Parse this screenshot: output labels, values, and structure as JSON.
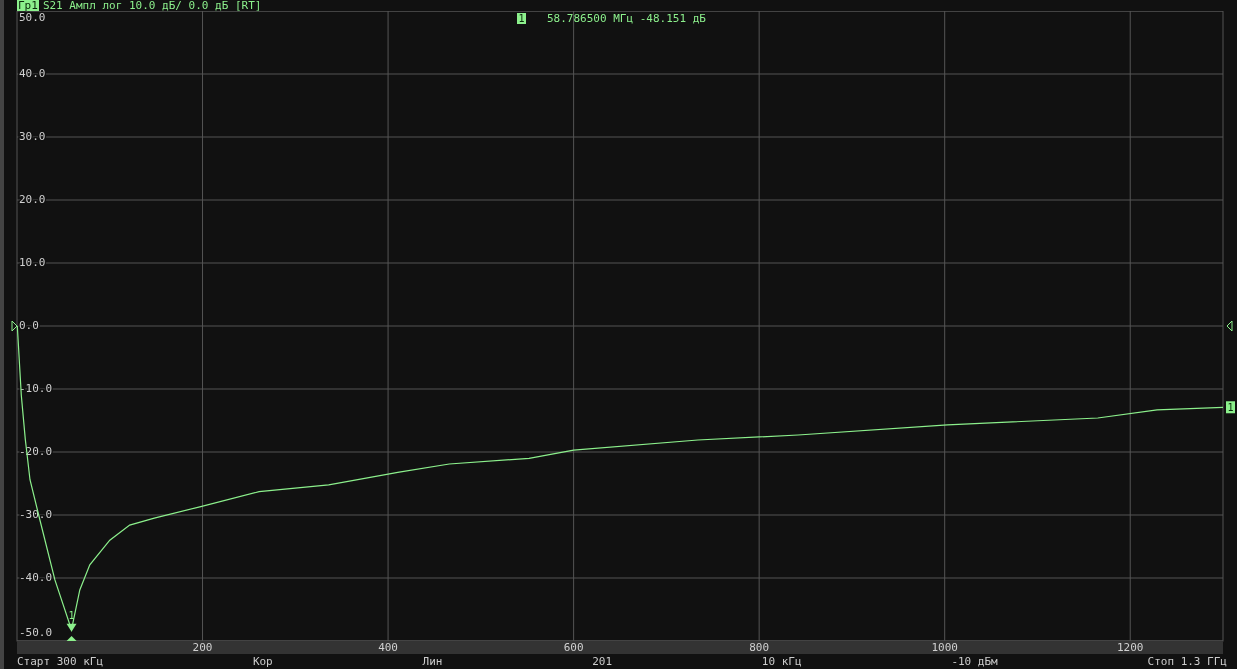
{
  "header": {
    "badge": "Гр1",
    "title": "S21 Ампл лог 10.0 дБ/ 0.0 дБ [RT]"
  },
  "marker_readout": {
    "label": "1",
    "text": "58.786500 МГц -48.151 дБ"
  },
  "trace_marker_label": "1",
  "trace_end_label": "1",
  "chart_data": {
    "type": "line",
    "xlim": [
      0,
      1300
    ],
    "ylim": [
      -50,
      50
    ],
    "xticks": [
      200,
      400,
      600,
      800,
      1000,
      1200
    ],
    "yticks": [
      {
        "value": 50,
        "label": "50.0"
      },
      {
        "value": 40,
        "label": "40.0"
      },
      {
        "value": 30,
        "label": "30.0"
      },
      {
        "value": 20,
        "label": "20.0"
      },
      {
        "value": 10,
        "label": "10.0"
      },
      {
        "value": 0,
        "label": "0.0"
      },
      {
        "value": -10,
        "label": "-10.0"
      },
      {
        "value": -20,
        "label": "-20.0"
      },
      {
        "value": -30,
        "label": "-30.0"
      },
      {
        "value": -40,
        "label": "-40.0"
      },
      {
        "value": -50,
        "label": "-50.0"
      }
    ],
    "x": [
      0.3,
      4.6,
      8.9,
      14,
      24.7,
      40.9,
      58.8,
      67.7,
      78.5,
      100,
      121.5,
      148,
      197,
      261,
      336,
      412,
      466,
      552,
      600,
      734,
      842,
      1003,
      1165,
      1229,
      1300
    ],
    "series": [
      {
        "color": "#8cf08c",
        "values": [
          0,
          -11,
          -18,
          -24.4,
          -30.8,
          -40.3,
          -48.2,
          -41.9,
          -37.9,
          -34,
          -31.6,
          -30.5,
          -28.7,
          -26.3,
          -25.2,
          -23.2,
          -21.9,
          -21,
          -19.7,
          -18.1,
          -17.3,
          -15.7,
          -14.6,
          -13.3,
          -12.9
        ]
      }
    ],
    "grid": true
  },
  "status_bar": [
    "Старт 300 кГц",
    "Кор",
    "Лин",
    "201",
    "10 кГц",
    "-10 дБм",
    "Стоп 1.3 ГГц"
  ]
}
